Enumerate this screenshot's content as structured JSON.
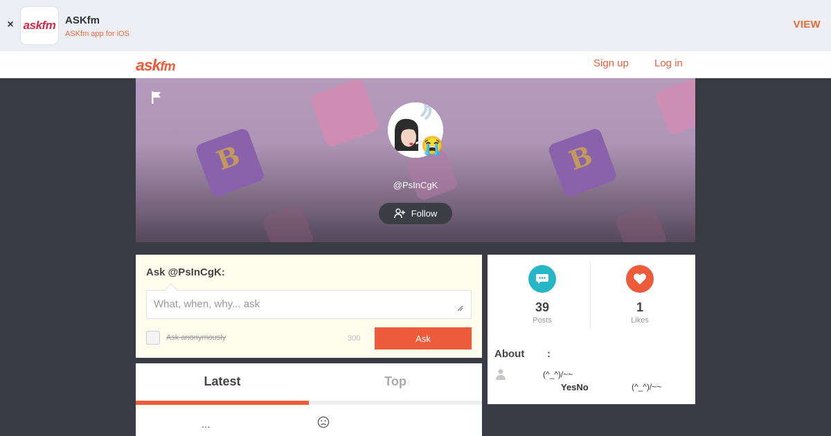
{
  "app_banner": {
    "close_label": "×",
    "logo_text": "askfm",
    "title": "ASKfm",
    "subtitle": "ASKfm app for iOS",
    "view_label": "VIEW"
  },
  "nav": {
    "logo_ask": "ask",
    "logo_fm": "fm",
    "signup_label": "Sign up",
    "login_label": "Log in"
  },
  "profile": {
    "username": "@PsInCgK",
    "follow_label": "Follow",
    "mood_emoji": "😭",
    "cube_letter": "B"
  },
  "ask": {
    "title": "Ask @PsInCgK:",
    "placeholder": "What, when, why... ask",
    "anonymous_label": "Ask anonymously",
    "char_count": "300",
    "button_label": "Ask"
  },
  "tabs": {
    "latest_label": "Latest",
    "top_label": "Top",
    "row_dots": "..."
  },
  "stats": {
    "posts_count": "39",
    "posts_label": "Posts",
    "likes_count": "1",
    "likes_label": "Likes"
  },
  "about": {
    "title": "About",
    "colon": ":",
    "line1": "(^_^)/~~",
    "line2a": "YesNo",
    "line2b": "(^_^)/~~"
  },
  "colors": {
    "accent": "#ee5b3a",
    "posts_icon_bg": "#27b6c7",
    "ask_card_bg": "#fffded",
    "page_bg": "#3a3a44"
  }
}
